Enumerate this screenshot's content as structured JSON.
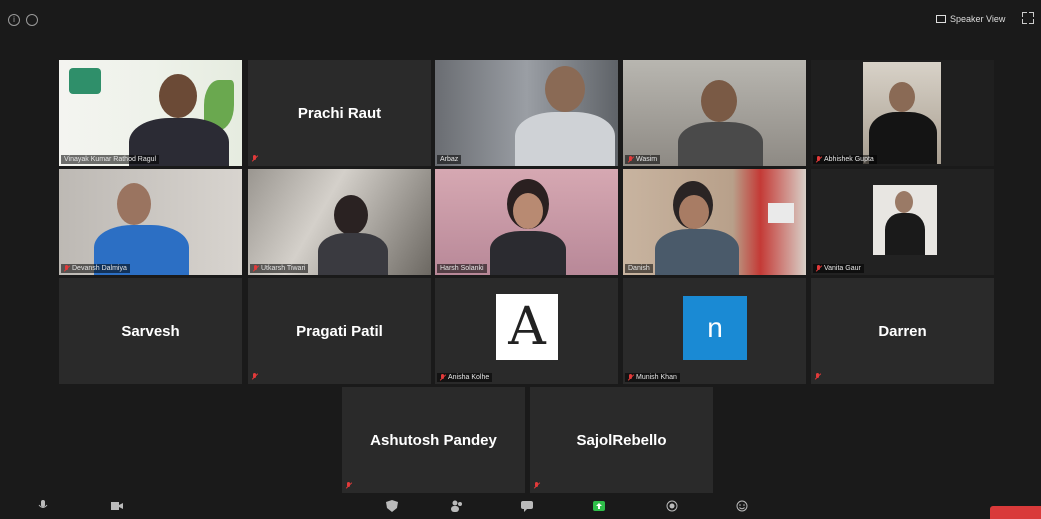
{
  "header": {
    "speaker_view_label": "Speaker View"
  },
  "participants": [
    {
      "name": "Vinayak Kumar Rathod Ragul",
      "type": "video",
      "active": true
    },
    {
      "name": "Prachi Raut",
      "type": "name",
      "muted": true
    },
    {
      "name": "Arbaz",
      "type": "video",
      "muted": false
    },
    {
      "name": "Wasim",
      "type": "video",
      "muted": true
    },
    {
      "name": "Abhishek Gupta",
      "type": "video",
      "muted": true
    },
    {
      "name": "Devansh Dalmiya",
      "type": "video",
      "muted": true
    },
    {
      "name": "Utkarsh Tiwari",
      "type": "video",
      "muted": true
    },
    {
      "name": "Harsh Solanki",
      "type": "video",
      "muted": false
    },
    {
      "name": "Danish",
      "type": "video",
      "muted": false
    },
    {
      "name": "Vanita Gaur",
      "type": "video",
      "muted": true
    },
    {
      "name": "Sarvesh",
      "type": "name",
      "muted": false
    },
    {
      "name": "Pragati Patil",
      "type": "name",
      "muted": true
    },
    {
      "name": "Anisha Kolhe",
      "type": "avatar",
      "avatar": "A",
      "muted": true
    },
    {
      "name": "Munish Khan",
      "type": "avatar",
      "avatar": "n",
      "muted": true
    },
    {
      "name": "Darren",
      "type": "name",
      "muted": true
    },
    {
      "name": "Ashutosh Pandey",
      "type": "name",
      "muted": true
    },
    {
      "name": "SajolRebello",
      "type": "name",
      "muted": true
    }
  ],
  "colors": {
    "active_border": "#d9d84a",
    "mute": "#e23a3a",
    "tile_bg": "#2a2a2a",
    "avatar_blue": "#1a8ad4"
  }
}
